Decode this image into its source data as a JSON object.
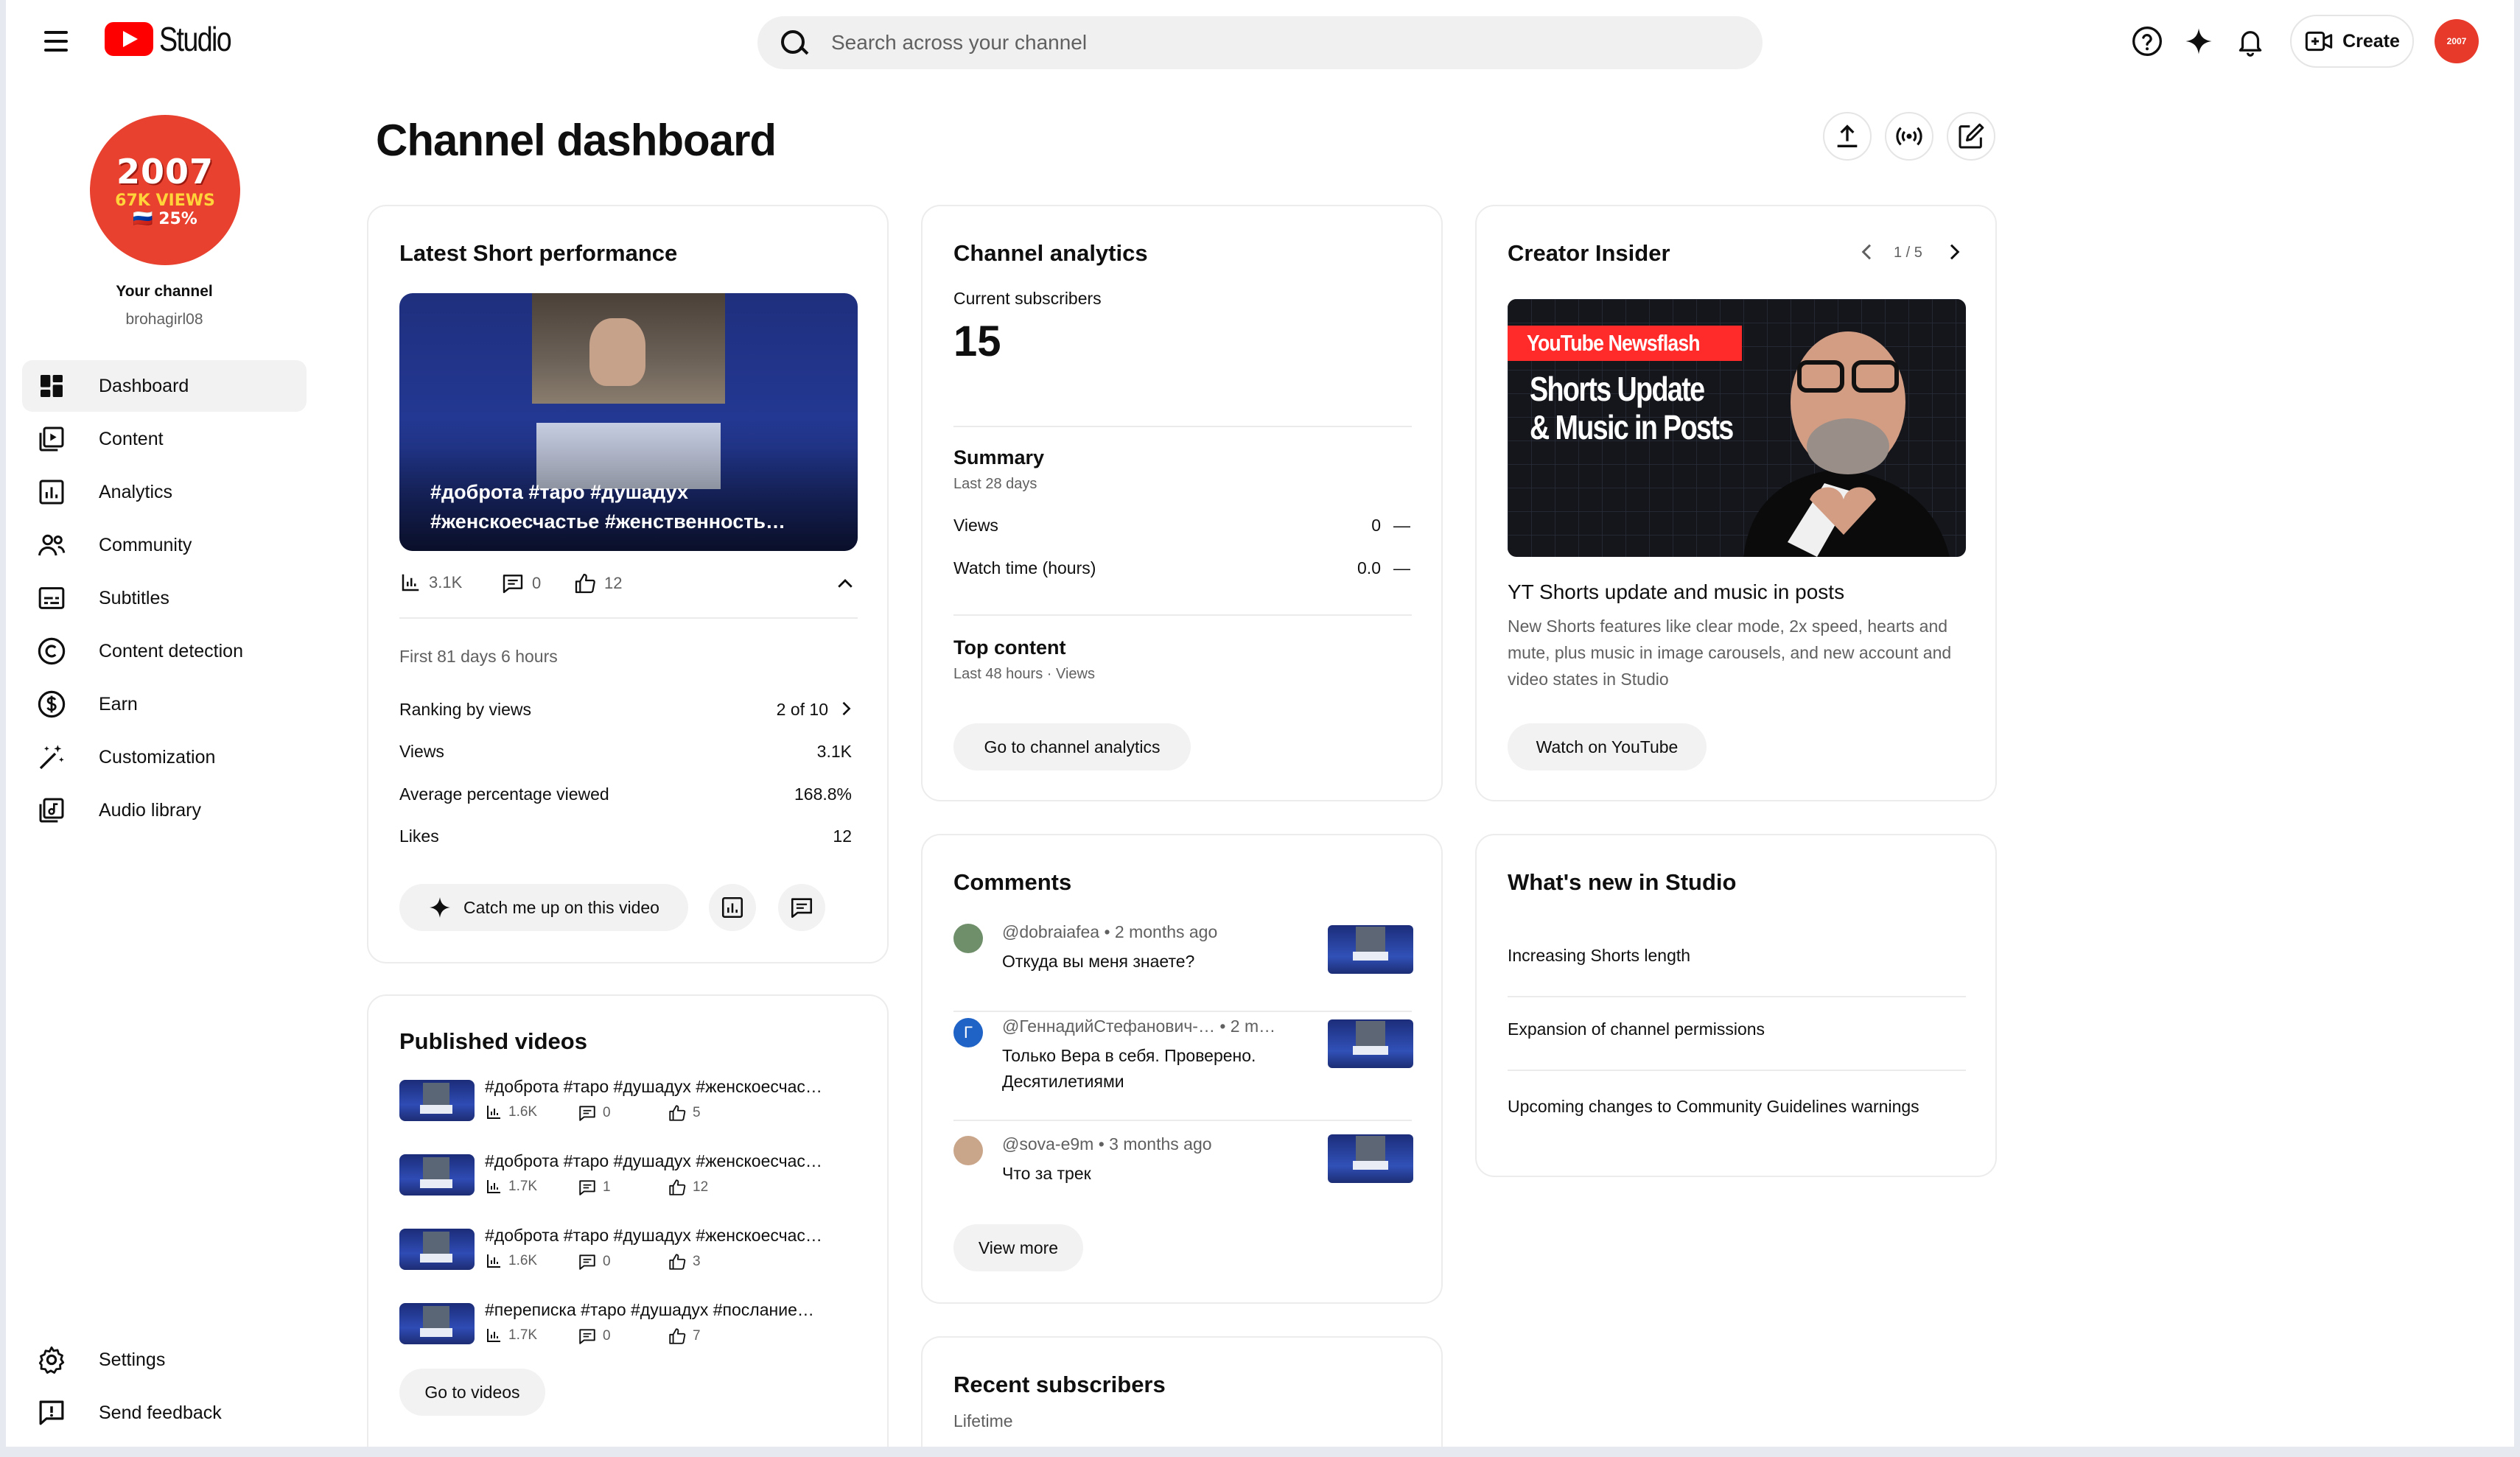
{
  "header": {
    "app_name": "Studio",
    "search_placeholder": "Search across your channel",
    "create_label": "Create",
    "avatar_text": "2007"
  },
  "sidebar": {
    "avatar": {
      "line1": "2007",
      "line2": "67K VIEWS",
      "line3": "🇷🇺 25%"
    },
    "channel_title": "Your channel",
    "channel_handle": "brohagirl08",
    "items": [
      {
        "label": "Dashboard",
        "icon": "dashboard-icon",
        "active": true
      },
      {
        "label": "Content",
        "icon": "content-icon"
      },
      {
        "label": "Analytics",
        "icon": "analytics-icon"
      },
      {
        "label": "Community",
        "icon": "community-icon"
      },
      {
        "label": "Subtitles",
        "icon": "subtitles-icon"
      },
      {
        "label": "Content detection",
        "icon": "copyright-icon"
      },
      {
        "label": "Earn",
        "icon": "dollar-icon"
      },
      {
        "label": "Customization",
        "icon": "magic-wand-icon"
      },
      {
        "label": "Audio library",
        "icon": "audio-library-icon"
      }
    ],
    "bottom_items": [
      {
        "label": "Settings",
        "icon": "gear-icon"
      },
      {
        "label": "Send feedback",
        "icon": "feedback-icon"
      }
    ]
  },
  "page": {
    "title": "Channel dashboard"
  },
  "latest_short": {
    "title": "Latest Short performance",
    "thumbnail_caption": "#доброта #таро #душадух #женскоесчастье #женственность…",
    "stats": {
      "views": "3.1K",
      "comments": "0",
      "likes": "12"
    },
    "period": "First 81 days 6 hours",
    "rows": [
      {
        "label": "Ranking by views",
        "value": "2 of 10"
      },
      {
        "label": "Views",
        "value": "3.1K"
      },
      {
        "label": "Average percentage viewed",
        "value": "168.8%"
      },
      {
        "label": "Likes",
        "value": "12"
      }
    ],
    "catch_up_label": "Catch me up on this video"
  },
  "published_videos": {
    "title": "Published videos",
    "videos": [
      {
        "title": "#доброта #таро #душадух #женскоесчас…",
        "views": "1.6K",
        "comments": "0",
        "likes": "5"
      },
      {
        "title": "#доброта #таро #душадух #женскоесчас…",
        "views": "1.7K",
        "comments": "1",
        "likes": "12"
      },
      {
        "title": "#доброта #таро #душадух #женскоесчас…",
        "views": "1.6K",
        "comments": "0",
        "likes": "3"
      },
      {
        "title": "#переписка #таро #душадух #послание…",
        "views": "1.7K",
        "comments": "0",
        "likes": "7"
      }
    ],
    "button_label": "Go to videos"
  },
  "channel_analytics": {
    "title": "Channel analytics",
    "subscribers_label": "Current subscribers",
    "subscribers_value": "15",
    "summary_title": "Summary",
    "summary_period": "Last 28 days",
    "rows": [
      {
        "label": "Views",
        "value": "0",
        "trend": "—"
      },
      {
        "label": "Watch time (hours)",
        "value": "0.0",
        "trend": "—"
      }
    ],
    "top_content_title": "Top content",
    "top_content_period": "Last 48 hours · Views",
    "button_label": "Go to channel analytics"
  },
  "comments": {
    "title": "Comments",
    "items": [
      {
        "author": "@dobraiafea",
        "time": "• 2 months ago",
        "text": "Откуда вы меня знаете?",
        "avatar_color": "#6f8f6a",
        "initial": ""
      },
      {
        "author": "@ГеннадийСтефанович-…",
        "time": "• 2 m…",
        "text": "Только Вера в себя. Проверено. Десятилетиями",
        "avatar_color": "#1f63c6",
        "initial": "Г"
      },
      {
        "author": "@sova-e9m",
        "time": "• 3 months ago",
        "text": "Что за трек",
        "avatar_color": "#c9a58a",
        "initial": ""
      }
    ],
    "button_label": "View more"
  },
  "recent_subscribers": {
    "title": "Recent subscribers",
    "period": "Lifetime"
  },
  "creator_insider": {
    "title": "Creator Insider",
    "pager": "1 / 5",
    "banner_tag": "YouTube Newsflash",
    "banner_headline_1": "Shorts Update",
    "banner_headline_2": "& Music in Posts",
    "video_title": "YT Shorts update and music in posts",
    "description": "New Shorts features like clear mode, 2x speed, hearts and mute, plus music in image carousels, and new account and video states in Studio",
    "button_label": "Watch on YouTube"
  },
  "whats_new": {
    "title": "What's new in Studio",
    "items": [
      "Increasing Shorts length",
      "Expansion of channel permissions",
      "Upcoming changes to Community Guidelines warnings"
    ]
  },
  "colors": {
    "brand_red": "#ff0000",
    "text": "#0f0f0f",
    "secondary": "#606060",
    "pill_bg": "#f2f2f2"
  }
}
